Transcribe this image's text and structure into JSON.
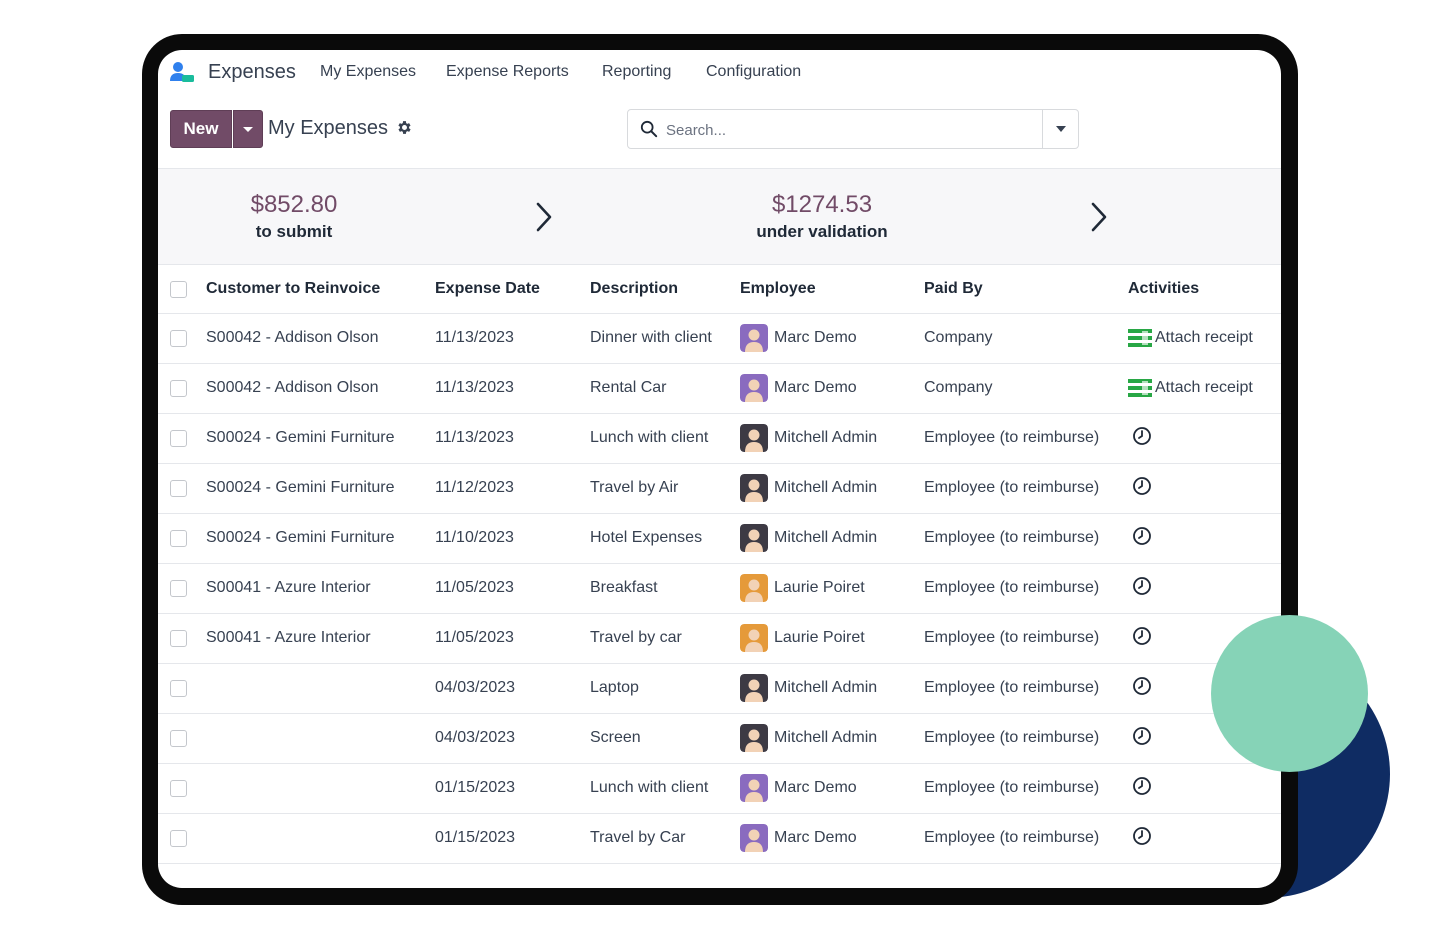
{
  "navbar": {
    "app_name": "Expenses",
    "menus": [
      "My Expenses",
      "Expense Reports",
      "Reporting",
      "Configuration"
    ]
  },
  "control": {
    "new_label": "New",
    "breadcrumb": "My Expenses",
    "search_placeholder": "Search..."
  },
  "summary": {
    "to_submit": {
      "amount": "$852.80",
      "label": "to submit"
    },
    "under_validation": {
      "amount": "$1274.53",
      "label": "under validation"
    }
  },
  "table": {
    "columns": [
      "Customer to Reinvoice",
      "Expense Date",
      "Description",
      "Employee",
      "Paid By",
      "Activities"
    ],
    "rows": [
      {
        "customer": "S00042 - Addison Olson",
        "date": "11/13/2023",
        "description": "Dinner with client",
        "employee": "Marc Demo",
        "paid_by": "Company",
        "activity": "Attach receipt"
      },
      {
        "customer": "S00042 - Addison Olson",
        "date": "11/13/2023",
        "description": "Rental Car",
        "employee": "Marc Demo",
        "paid_by": "Company",
        "activity": "Attach receipt"
      },
      {
        "customer": "S00024 - Gemini Furniture",
        "date": "11/13/2023",
        "description": "Lunch with client",
        "employee": "Mitchell Admin",
        "paid_by": "Employee (to reimburse)",
        "activity": ""
      },
      {
        "customer": "S00024 - Gemini Furniture",
        "date": "11/12/2023",
        "description": "Travel by Air",
        "employee": "Mitchell Admin",
        "paid_by": "Employee (to reimburse)",
        "activity": ""
      },
      {
        "customer": "S00024 - Gemini Furniture",
        "date": "11/10/2023",
        "description": "Hotel Expenses",
        "employee": "Mitchell Admin",
        "paid_by": "Employee (to reimburse)",
        "activity": ""
      },
      {
        "customer": "S00041 - Azure Interior",
        "date": "11/05/2023",
        "description": "Breakfast",
        "employee": "Laurie Poiret",
        "paid_by": "Employee (to reimburse)",
        "activity": ""
      },
      {
        "customer": "S00041 - Azure Interior",
        "date": "11/05/2023",
        "description": "Travel by car",
        "employee": "Laurie Poiret",
        "paid_by": "Employee (to reimburse)",
        "activity": ""
      },
      {
        "customer": "",
        "date": "04/03/2023",
        "description": "Laptop",
        "employee": "Mitchell Admin",
        "paid_by": "Employee (to reimburse)",
        "activity": ""
      },
      {
        "customer": "",
        "date": "04/03/2023",
        "description": "Screen",
        "employee": "Mitchell Admin",
        "paid_by": "Employee (to reimburse)",
        "activity": ""
      },
      {
        "customer": "",
        "date": "01/15/2023",
        "description": "Lunch with client",
        "employee": "Marc Demo",
        "paid_by": "Employee (to reimburse)",
        "activity": ""
      },
      {
        "customer": "",
        "date": "01/15/2023",
        "description": "Travel by Car",
        "employee": "Marc Demo",
        "paid_by": "Employee (to reimburse)",
        "activity": ""
      }
    ]
  },
  "colors": {
    "brand": "#714b67",
    "deco_green": "#86d3b7",
    "deco_navy": "#0f2c63",
    "device_frame": "#0a0a0a"
  }
}
